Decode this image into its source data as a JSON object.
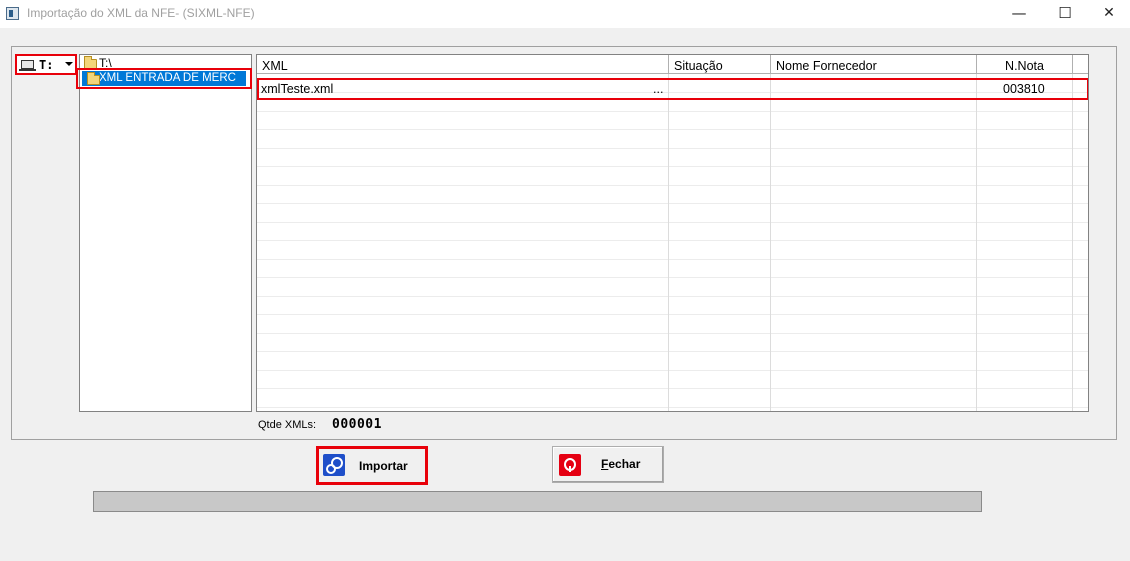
{
  "window": {
    "title": "Importação do XML da NFE- (SIXML-NFE)",
    "minimize_glyph": "—",
    "maximize_glyph": "☐",
    "close_glyph": "✕"
  },
  "drive": {
    "selected": "T:"
  },
  "tree": {
    "root": "T:\\",
    "selected_folder": "XML ENTRADA DE MERC"
  },
  "grid": {
    "columns": [
      "XML",
      "Situação",
      "Nome Fornecedor",
      "N.Nota"
    ],
    "rows": [
      {
        "xml": "xmlTeste.xml",
        "ellipsis": "...",
        "situacao": "",
        "fornecedor": "",
        "nota": "003810"
      }
    ]
  },
  "summary": {
    "qtde_label": "Qtde XMLs:",
    "qtde_value": "000001"
  },
  "buttons": {
    "importar": "Importar",
    "fechar_first": "F",
    "fechar_rest": "echar"
  },
  "progress": {
    "value": 0
  },
  "colors": {
    "highlight": "#e8000a",
    "selection": "#0078d7",
    "import_icon": "#1f4fc9",
    "close_icon": "#e50012"
  },
  "icons": {
    "app": "app-icon",
    "drive": "drive-icon",
    "folder": "folder-icon",
    "import": "gears-icon",
    "close": "close-icon"
  }
}
